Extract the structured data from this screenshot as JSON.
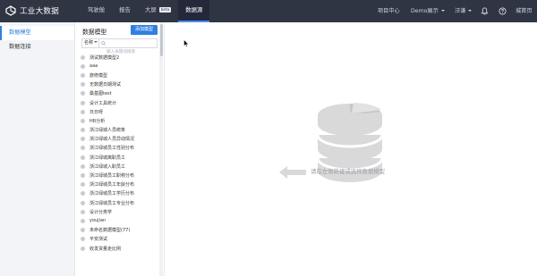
{
  "app": {
    "title": "工业大数据"
  },
  "nav": {
    "items": [
      {
        "label": "驾驶舱"
      },
      {
        "label": "报告"
      },
      {
        "label": "大屏",
        "badge": "beta"
      },
      {
        "label": "数据源"
      }
    ],
    "active": 3
  },
  "right_nav": {
    "project_center": "项目中心",
    "demo": "Demo展示",
    "user": "汪谦",
    "home": "城首页"
  },
  "left_nav": {
    "items": [
      {
        "label": "数据模型"
      },
      {
        "label": "数据连接"
      }
    ],
    "active": 0
  },
  "panel": {
    "title": "数据模型",
    "new_button": "添加模型",
    "filter_select": "名称",
    "search_placeholder": "输入关键词搜索",
    "items": [
      "测试数据模型2",
      "aaa",
      "旅修模型",
      "无数据日期测试",
      "桑基图test",
      "设计工具统计",
      "日日呀",
      "HR分析",
      "浙江绿城人员统筹",
      "浙江绿城人员异动情况",
      "浙江绿城员工性别分布",
      "浙江绿城离职员工",
      "浙江绿城入职员工",
      "浙江绿城员工职称分布",
      "浙江绿城员工年龄分布",
      "浙江绿城员工学历分布",
      "浙江绿城员工专业分布",
      "设计分类学",
      "youjian",
      "未命名数据模型(77)",
      "平安测试",
      "收发货量走比例"
    ]
  },
  "main": {
    "empty_text": "请在左侧新建或选择数据模型"
  },
  "colors": {
    "topbar": "#2f3543",
    "accent": "#2f7fe0",
    "illustration": "#d9d9d9"
  }
}
